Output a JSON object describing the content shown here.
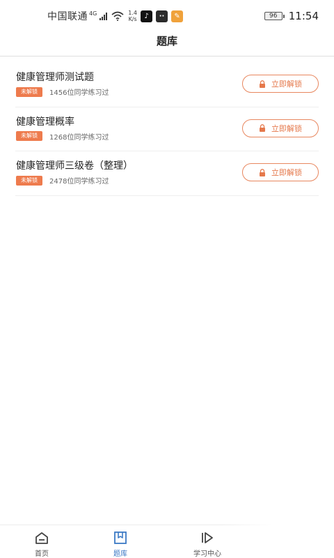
{
  "status_bar": {
    "carrier": "中国联通",
    "network_label": "4G",
    "speed_value": "1.4",
    "speed_unit": "K/s",
    "battery": "96",
    "time": "11:54"
  },
  "header": {
    "title": "题库"
  },
  "items": [
    {
      "title": "健康管理师测试题",
      "tag": "未解锁",
      "count": "1456位同学练习过",
      "button": "立即解锁"
    },
    {
      "title": "健康管理概率",
      "tag": "未解锁",
      "count": "1268位同学练习过",
      "button": "立即解锁"
    },
    {
      "title": "健康管理师三级卷（整理）",
      "tag": "未解锁",
      "count": "2478位同学练习过",
      "button": "立即解锁"
    }
  ],
  "tabbar": {
    "tabs": [
      {
        "label": "首页",
        "icon": "home-icon",
        "active": false
      },
      {
        "label": "题库",
        "icon": "book-icon",
        "active": true
      },
      {
        "label": "学习中心",
        "icon": "play-icon",
        "active": false
      }
    ]
  },
  "colors": {
    "accent": "#ee7b4d",
    "active_tab": "#3b79c5"
  }
}
